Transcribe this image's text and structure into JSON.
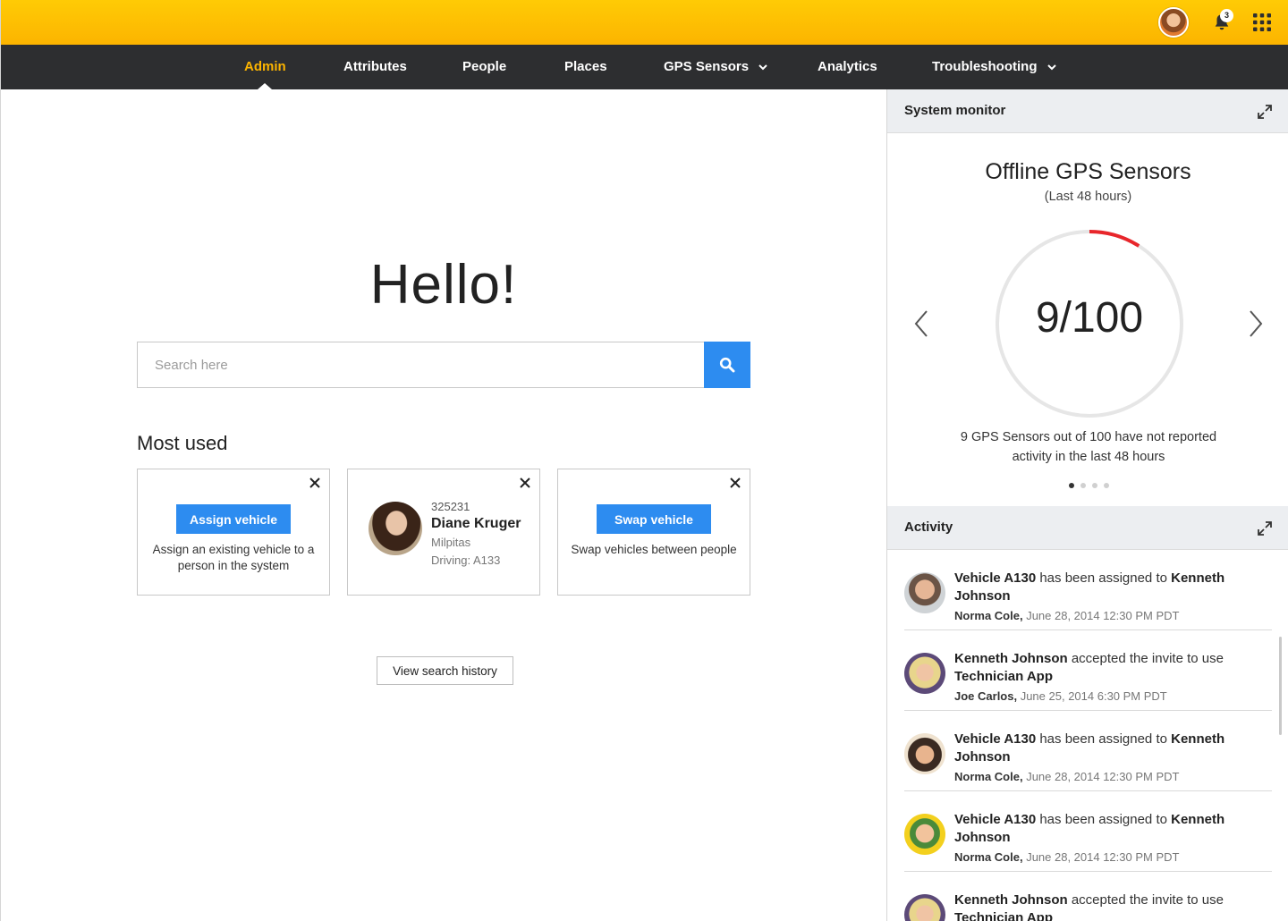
{
  "header": {
    "notification_count": "3",
    "accent_color": "#fcb400",
    "icons": [
      "user-avatar",
      "bell-icon",
      "apps-grid-icon"
    ]
  },
  "nav": {
    "items": [
      {
        "label": "Admin",
        "active": true
      },
      {
        "label": "Attributes"
      },
      {
        "label": "People"
      },
      {
        "label": "Places"
      },
      {
        "label": "GPS Sensors",
        "dropdown": true
      },
      {
        "label": "Analytics"
      },
      {
        "label": "Troubleshooting",
        "dropdown": true
      }
    ]
  },
  "main": {
    "greeting": "Hello!",
    "search_placeholder": "Search here",
    "most_used_title": "Most used",
    "cards": [
      {
        "button": "Assign vehicle",
        "description": "Assign an existing vehicle to a person in the system"
      },
      {
        "id": "325231",
        "name": "Diane Kruger",
        "city": "Milpitas",
        "driving": "Driving: A133"
      },
      {
        "button": "Swap vehicle",
        "description": "Swap vehicles between people"
      }
    ],
    "history_button": "View search history"
  },
  "system_monitor": {
    "header": "System monitor",
    "title": "Offline GPS Sensors",
    "subtitle": "(Last 48 hours)",
    "value_display": "9/100",
    "value": 9,
    "total": 100,
    "description": "9 GPS Sensors out of 100 have not reported activity in the last 48 hours",
    "page_count": 4,
    "current_page": 1,
    "alert_color": "#e8262b"
  },
  "activity": {
    "header": "Activity",
    "items": [
      {
        "subject": "Vehicle A130",
        "action": " has been assigned to ",
        "object": "Kenneth Johnson",
        "actor": "Norma Cole,",
        "time": " June 28, 2014 12:30 PM PDT"
      },
      {
        "subject": "Kenneth Johnson",
        "action": " accepted the invite to use ",
        "object": "Technician App",
        "actor": "Joe Carlos,",
        "time": " June 25, 2014 6:30 PM PDT"
      },
      {
        "subject": "Vehicle A130",
        "action": " has been assigned to ",
        "object": "Kenneth Johnson",
        "actor": "Norma Cole,",
        "time": " June 28, 2014 12:30 PM PDT"
      },
      {
        "subject": "Vehicle A130",
        "action": " has been assigned to ",
        "object": "Kenneth Johnson",
        "actor": "Norma Cole,",
        "time": " June 28, 2014 12:30 PM PDT"
      },
      {
        "subject": "Kenneth Johnson",
        "action": " accepted the invite to use ",
        "object": "Technician App",
        "actor": "",
        "time": ""
      }
    ]
  }
}
